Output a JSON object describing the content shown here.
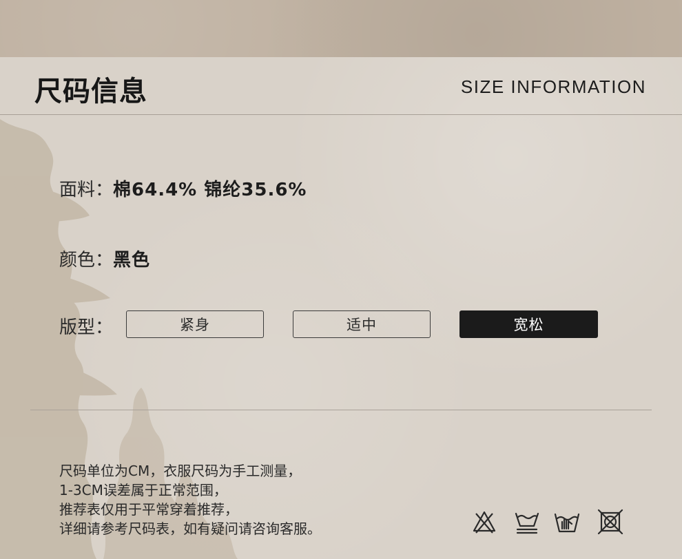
{
  "header": {
    "title_cn": "尺码信息",
    "title_en": "SIZE  INFORMATION"
  },
  "fabric": {
    "label": "面料：",
    "value": "棉64.4% 锦纶35.6%"
  },
  "color": {
    "label": "颜色：",
    "value": "黑色"
  },
  "fit": {
    "label": "版型：",
    "options": [
      "紧身",
      "适中",
      "宽松"
    ],
    "selected": "宽松"
  },
  "notes": [
    "尺码单位为CM，衣服尺码为手工测量，",
    "1-3CM误差属于正常范围，",
    "推荐表仅用于平常穿着推荐，",
    "详细请参考尺码表，如有疑问请咨询客服。"
  ],
  "care_icons": [
    "no-bleach-icon",
    "wash-30-icon",
    "hand-wash-icon",
    "no-tumble-dry-icon"
  ],
  "colors": {
    "accent": "#1b1b1b",
    "paper": "#d9d2c9",
    "band": "#bfb1a1"
  }
}
